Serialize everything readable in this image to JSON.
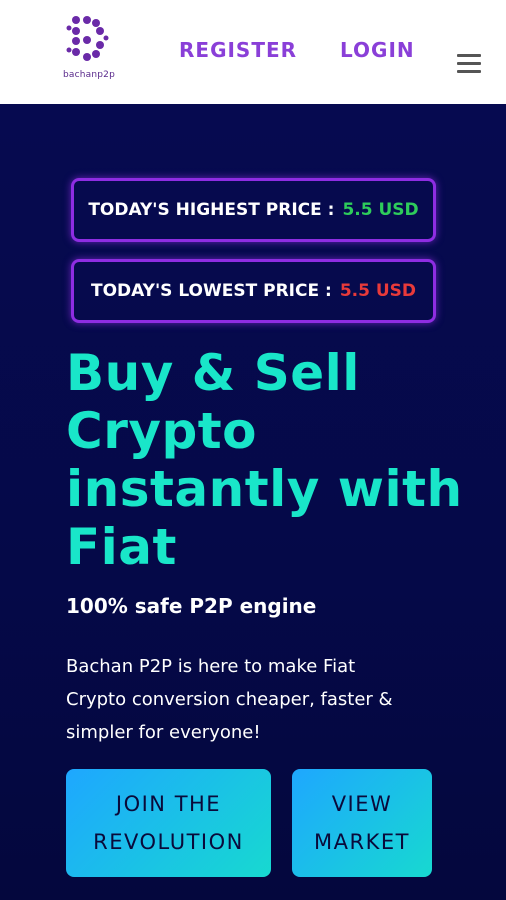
{
  "header": {
    "logo_text": "bachanp2p",
    "nav": {
      "register": "REGISTER",
      "login": "LOGIN"
    },
    "menu_icon": "hamburger-menu-icon"
  },
  "prices": {
    "highest_label": "TODAY'S HIGHEST PRICE :",
    "highest_value": "5.5 USD",
    "lowest_label": "TODAY'S LOWEST PRICE :",
    "lowest_value": "5.5 USD"
  },
  "hero": {
    "headline_line1": "Buy & Sell",
    "headline_line2": "Crypto",
    "headline_line3": "instantly with",
    "headline_line4": "Fiat",
    "subheadline": "100% safe P2P engine",
    "description_line1": "Bachan P2P is here to make Fiat",
    "description_line2": "Crypto conversion cheaper, faster &",
    "description_line3": "simpler for everyone!",
    "join_line1": "JOIN THE",
    "join_line2": "REVOLUTION",
    "view_line1": "VIEW",
    "view_line2": "MARKET"
  },
  "colors": {
    "brand_purple": "#8a3fd8",
    "accent_teal": "#19e6c9",
    "background_navy": "#050a4a",
    "price_high_green": "#2ecc5b",
    "price_low_red": "#e83a3a"
  }
}
